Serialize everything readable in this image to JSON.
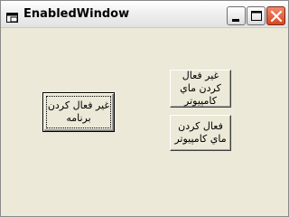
{
  "window": {
    "title": "EnabledWindow",
    "icon": "window-app-icon",
    "controls": {
      "minimize": "minimize-icon",
      "maximize": "maximize-icon",
      "close": "close-icon"
    }
  },
  "buttons": {
    "disable_program": "غير فعال كردن برنامه",
    "disable_my_computer": "غير فعال كردن ماي كامپيوتر",
    "enable_my_computer": "فعال كردن ماي كامپيوتر"
  },
  "colors": {
    "face": "#ece9d8",
    "close_button": "#d8461f"
  }
}
